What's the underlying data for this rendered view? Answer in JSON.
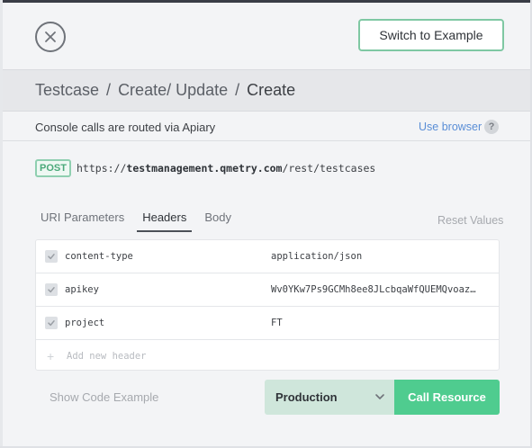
{
  "header": {
    "switch_label": "Switch to Example"
  },
  "breadcrumb": {
    "items": [
      "Testcase",
      "Create/ Update",
      "Create"
    ],
    "separator": "/"
  },
  "console": {
    "routing_text": "Console calls are routed via Apiary",
    "use_browser_label": "Use browser",
    "help_label": "?"
  },
  "request": {
    "method": "POST",
    "url_scheme": "https://",
    "url_host": "testmanagement.qmetry.com",
    "url_path": "/rest/testcases"
  },
  "tabs": {
    "items": [
      "URI Parameters",
      "Headers",
      "Body"
    ],
    "active": "Headers",
    "reset_label": "Reset Values"
  },
  "headers": {
    "rows": [
      {
        "key": "content-type",
        "value": "application/json",
        "checked": true
      },
      {
        "key": "apikey",
        "value": "Wv0YKw7Ps9GCMh8ee8JLcbqaWfQUEMQvoazl…",
        "checked": true
      },
      {
        "key": "project",
        "value": "FT",
        "checked": true
      }
    ],
    "add_placeholder": "Add new header"
  },
  "footer": {
    "show_code_label": "Show Code Example",
    "environment": "Production",
    "call_label": "Call Resource"
  },
  "colors": {
    "accent_green": "#4fcc8f",
    "link_blue": "#5a8ed6",
    "method_green": "#4aa97a"
  },
  "icons": {
    "close": "close-icon",
    "check": "check-icon",
    "plus": "plus-icon",
    "chevron": "chevron-down-icon",
    "help": "help-icon"
  }
}
